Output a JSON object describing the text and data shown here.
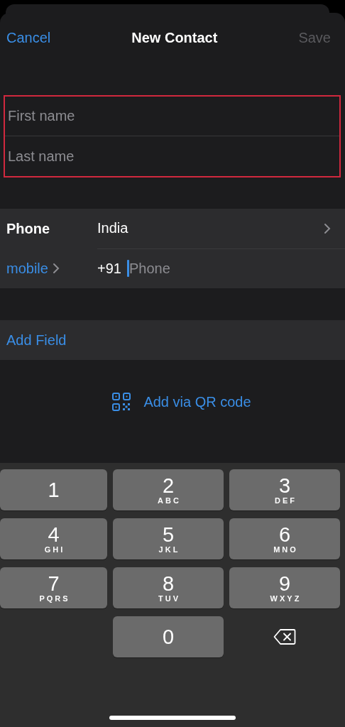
{
  "nav": {
    "cancel": "Cancel",
    "title": "New Contact",
    "save": {
      "label": "Save",
      "disabled": true
    }
  },
  "name_section": {
    "highlighted": true,
    "fields": [
      {
        "placeholder": "First name"
      },
      {
        "placeholder": "Last name"
      }
    ]
  },
  "phone_section": {
    "label": "Phone",
    "country": "India",
    "type_label": "mobile",
    "prefix": "+91",
    "number": {
      "placeholder": "Phone",
      "focused": true
    }
  },
  "add_field": "Add Field",
  "qr_link": "Add via QR code",
  "keypad": [
    {
      "kind": "digit",
      "digit": "1"
    },
    {
      "kind": "digit",
      "digit": "2",
      "letters": "ABC"
    },
    {
      "kind": "digit",
      "digit": "3",
      "letters": "DEF"
    },
    {
      "kind": "digit",
      "digit": "4",
      "letters": "GHI"
    },
    {
      "kind": "digit",
      "digit": "5",
      "letters": "JKL"
    },
    {
      "kind": "digit",
      "digit": "6",
      "letters": "MNO"
    },
    {
      "kind": "digit",
      "digit": "7",
      "letters": "PQRS"
    },
    {
      "kind": "digit",
      "digit": "8",
      "letters": "TUV"
    },
    {
      "kind": "digit",
      "digit": "9",
      "letters": "WXYZ"
    },
    {
      "kind": "blank"
    },
    {
      "kind": "digit",
      "digit": "0"
    },
    {
      "kind": "delete"
    }
  ]
}
